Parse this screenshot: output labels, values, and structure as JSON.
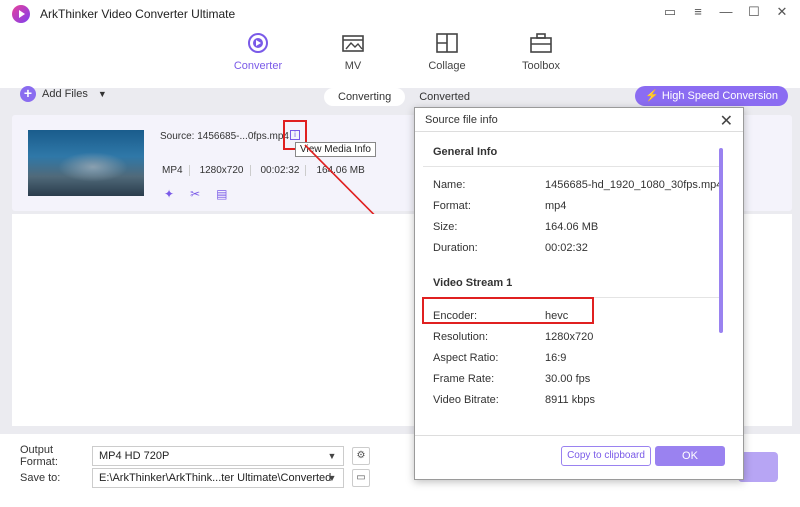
{
  "app": {
    "title": "ArkThinker Video Converter Ultimate"
  },
  "window_controls": [
    "chat-icon",
    "menu-icon",
    "minimize-icon",
    "maximize-icon",
    "close-icon"
  ],
  "nav": [
    {
      "label": "Converter",
      "icon": "converter-icon",
      "active": true
    },
    {
      "label": "MV",
      "icon": "mv-icon",
      "active": false
    },
    {
      "label": "Collage",
      "icon": "collage-icon",
      "active": false
    },
    {
      "label": "Toolbox",
      "icon": "toolbox-icon",
      "active": false
    }
  ],
  "toolbar": {
    "add_files": "Add Files",
    "tabs": [
      "Converting",
      "Converted"
    ],
    "high_speed": "High Speed Conversion"
  },
  "file": {
    "source": "Source: 1456685-...0fps.mp4",
    "tooltip": "View Media Info",
    "format": "MP4",
    "resolution": "1280x720",
    "duration": "00:02:32",
    "size": "164.06 MB"
  },
  "bottom": {
    "output_format_label": "Output Format:",
    "output_format_value": "MP4 HD 720P",
    "save_to_label": "Save to:",
    "save_to_value": "E:\\ArkThinker\\ArkThink...ter Ultimate\\Converted"
  },
  "dialog": {
    "title": "Source file info",
    "general": {
      "heading": "General Info",
      "rows": [
        {
          "k": "Name:",
          "v": "1456685-hd_1920_1080_30fps.mp4"
        },
        {
          "k": "Format:",
          "v": "mp4"
        },
        {
          "k": "Size:",
          "v": "164.06 MB"
        },
        {
          "k": "Duration:",
          "v": "00:02:32"
        }
      ]
    },
    "video": {
      "heading": "Video Stream 1",
      "rows": [
        {
          "k": "Encoder:",
          "v": "hevc"
        },
        {
          "k": "Resolution:",
          "v": "1280x720"
        },
        {
          "k": "Aspect Ratio:",
          "v": "16:9"
        },
        {
          "k": "Frame Rate:",
          "v": "30.00 fps"
        },
        {
          "k": "Video Bitrate:",
          "v": "8911 kbps"
        }
      ]
    },
    "copy_button": "Copy to clipboard",
    "ok_button": "OK"
  },
  "colors": {
    "accent": "#8b6cf2",
    "highlight": "#e02020"
  }
}
